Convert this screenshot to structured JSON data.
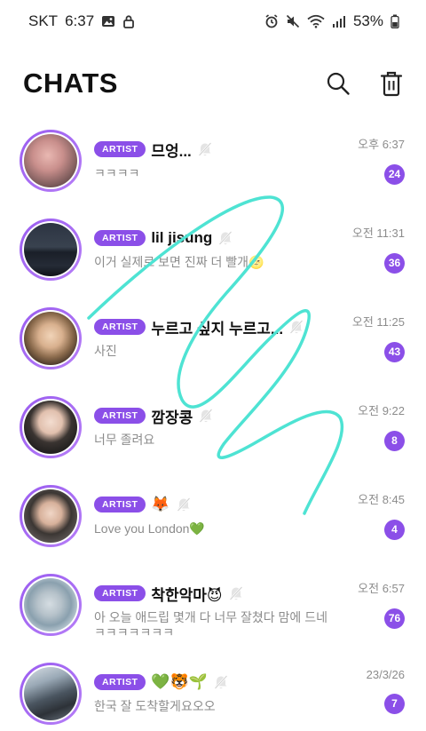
{
  "status_bar": {
    "carrier": "SKT",
    "time": "6:37",
    "battery": "53%"
  },
  "header": {
    "title": "CHATS"
  },
  "chats": [
    {
      "badge": "ARTIST",
      "name": "므엉...",
      "message": "ㅋㅋㅋㅋ",
      "message_line2": "",
      "time": "오후 6:37",
      "unread": "24"
    },
    {
      "badge": "ARTIST",
      "name": "lil jisung",
      "message": "이거 실제로 보면 진짜 더 빨개🌝",
      "message_line2": "",
      "time": "오전 11:31",
      "unread": "36"
    },
    {
      "badge": "ARTIST",
      "name": "누르고 싶지 누르고...",
      "message": "사진",
      "message_line2": "",
      "time": "오전 11:25",
      "unread": "43"
    },
    {
      "badge": "ARTIST",
      "name": "깜장콩",
      "message": "너무 졸려요",
      "message_line2": "",
      "time": "오전 9:22",
      "unread": "8"
    },
    {
      "badge": "ARTIST",
      "name": "🦊",
      "message": "Love you London💚",
      "message_line2": "",
      "time": "오전 8:45",
      "unread": "4"
    },
    {
      "badge": "ARTIST",
      "name": "착한악마😈",
      "message": "아 오늘 애드립 몇개 다 너무 잘쳤다 맘에 드네",
      "message_line2": "ㅋㅋㅋㅋㅋㅋㅋ",
      "time": "오전 6:57",
      "unread": "76"
    },
    {
      "badge": "ARTIST",
      "name": "💚🐯🌱",
      "message": "한국 잘 도착할게요오오",
      "message_line2": "",
      "time": "23/3/26",
      "unread": "7"
    }
  ],
  "colors": {
    "accent": "#8b4fe8",
    "scribble": "#4ee3d3"
  }
}
